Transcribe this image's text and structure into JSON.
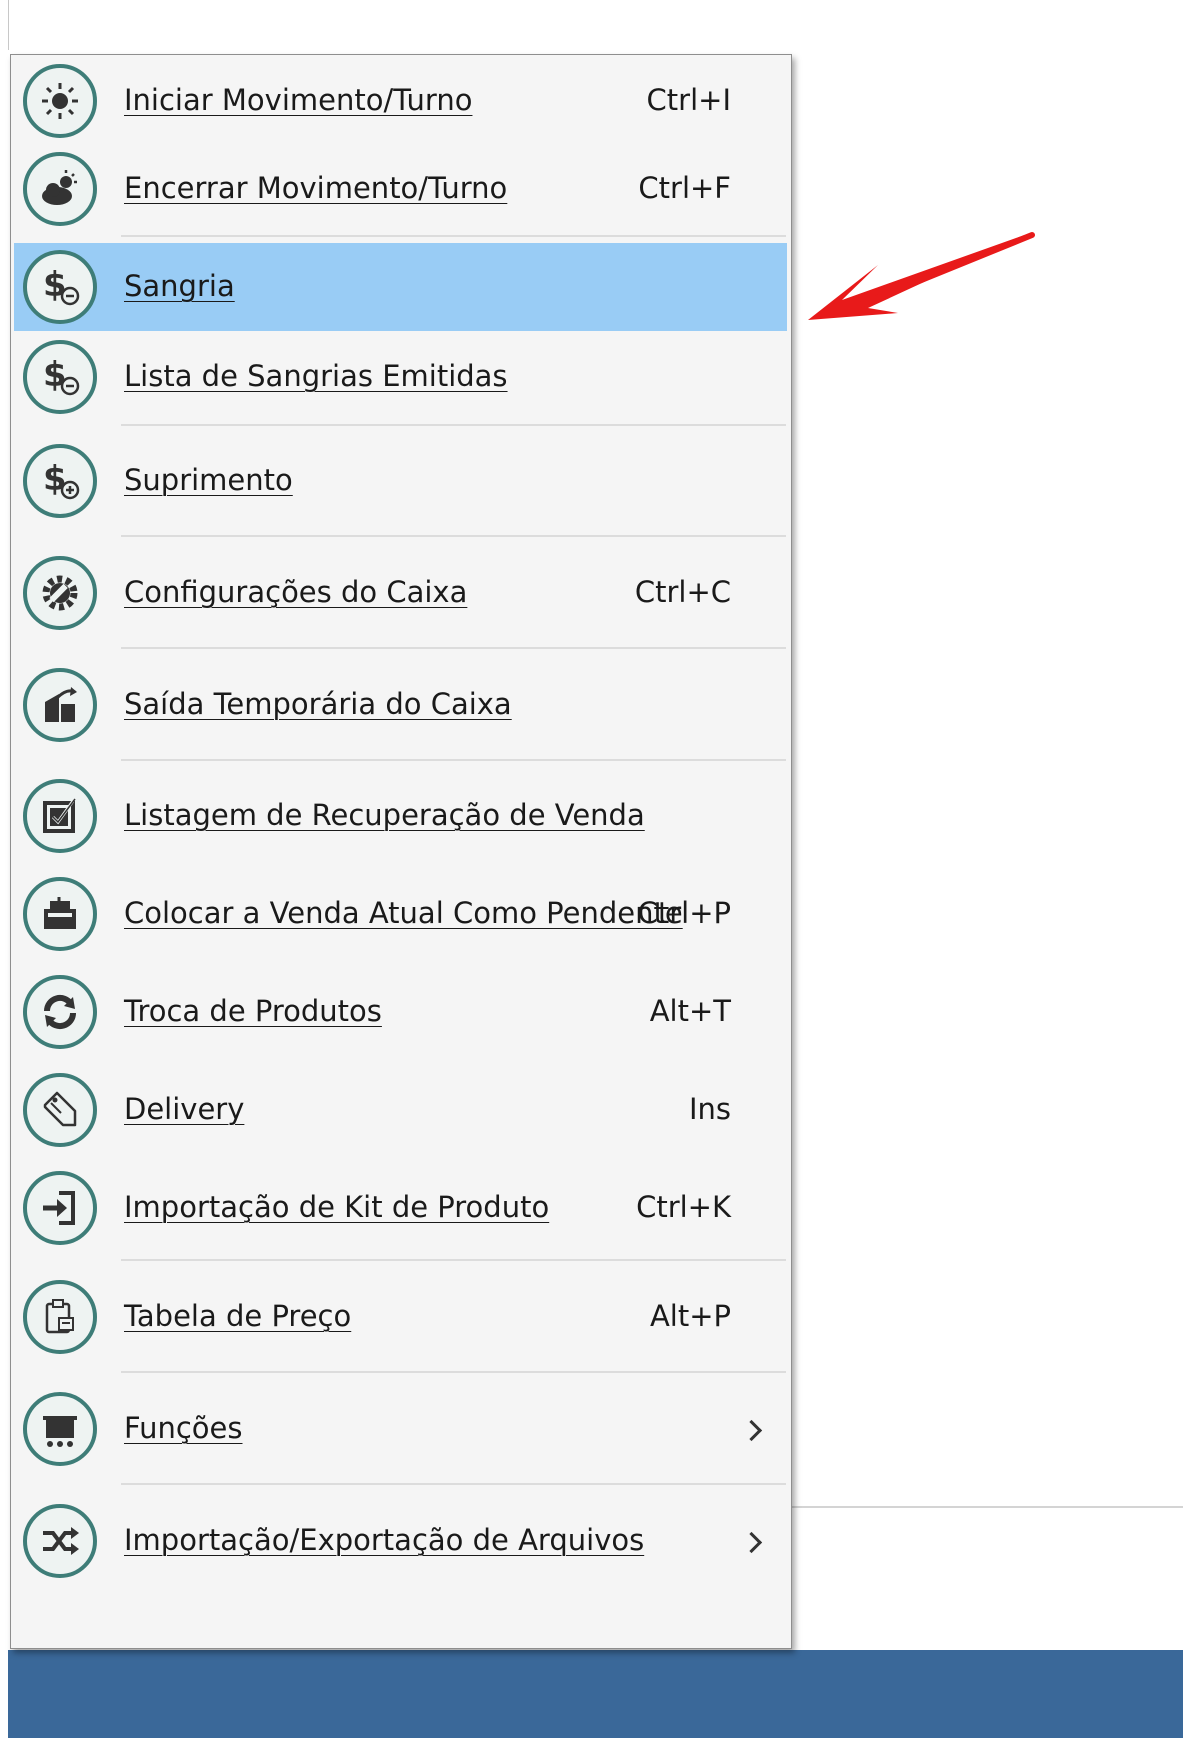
{
  "menu": {
    "items": [
      {
        "label": "Iniciar Movimento/Turno",
        "shortcut": "Ctrl+I",
        "icon": "sun-icon"
      },
      {
        "label": "Encerrar Movimento/Turno",
        "shortcut": "Ctrl+F",
        "icon": "sun-cloud-icon"
      },
      {
        "label": "Sangria",
        "shortcut": "",
        "icon": "dollar-minus-icon",
        "highlighted": true
      },
      {
        "label": "Lista de Sangrias Emitidas",
        "shortcut": "",
        "icon": "dollar-minus-icon"
      },
      {
        "label": "Suprimento",
        "shortcut": "",
        "icon": "dollar-plus-icon"
      },
      {
        "label": "Configurações do Caixa",
        "shortcut": "Ctrl+C",
        "icon": "gear-wrench-icon"
      },
      {
        "label": "Saída Temporária do Caixa",
        "shortcut": "",
        "icon": "exit-door-icon"
      },
      {
        "label": "Listagem de Recuperação de Venda",
        "shortcut": "",
        "icon": "checklist-icon"
      },
      {
        "label": "Colocar a Venda Atual Como Pendente",
        "shortcut": "Ctrl+P",
        "icon": "register-icon"
      },
      {
        "label": "Troca de Produtos",
        "shortcut": "Alt+T",
        "icon": "exchange-icon"
      },
      {
        "label": "Delivery",
        "shortcut": "Ins",
        "icon": "tag-icon"
      },
      {
        "label": "Importação de Kit de Produto",
        "shortcut": "Ctrl+K",
        "icon": "import-icon"
      },
      {
        "label": "Tabela de Preço",
        "shortcut": "Alt+P",
        "icon": "clipboard-icon"
      },
      {
        "label": "Funções",
        "shortcut": "",
        "icon": "cart-icon",
        "submenu": true
      },
      {
        "label": "Importação/Exportação de Arquivos",
        "shortcut": "",
        "icon": "shuffle-icon",
        "submenu": true
      }
    ]
  },
  "colors": {
    "highlight": "#99ccf5",
    "icon_ring": "#3e7d78",
    "annotation_arrow": "#e81a1a",
    "taskbar": "#3a6899"
  }
}
